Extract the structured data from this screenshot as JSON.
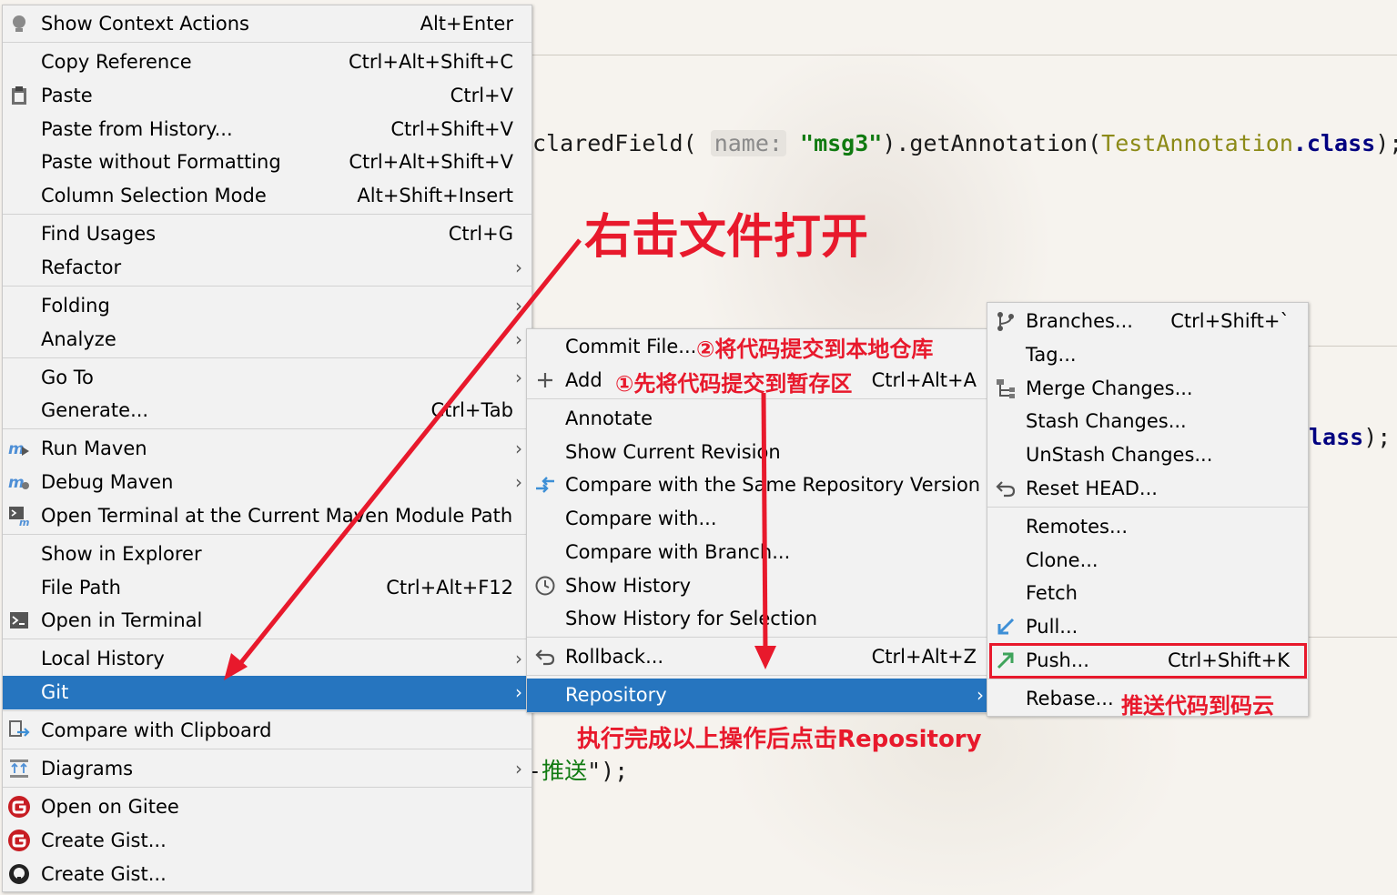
{
  "editor": {
    "line1": {
      "prefix": "claredField(",
      "hint": "name:",
      "str": "\"msg3\"",
      "mid": ").getAnnotation(",
      "cls": "TestAnnotation",
      "kw": ".class",
      "end": ");"
    },
    "line2": {
      "kw": "lass",
      "end": ");"
    },
    "line3": {
      "prefix": "-",
      "str": "推送",
      "end": "\");"
    }
  },
  "context_menu": {
    "items": [
      {
        "label": "Show Context Actions",
        "shortcut": "Alt+Enter",
        "icon": "lightbulb-icon"
      },
      {
        "label": "Copy Reference",
        "shortcut": "Ctrl+Alt+Shift+C"
      },
      {
        "label": "Paste",
        "shortcut": "Ctrl+V",
        "icon": "clipboard-icon"
      },
      {
        "label": "Paste from History...",
        "shortcut": "Ctrl+Shift+V"
      },
      {
        "label": "Paste without Formatting",
        "shortcut": "Ctrl+Alt+Shift+V"
      },
      {
        "label": "Column Selection Mode",
        "shortcut": "Alt+Shift+Insert"
      },
      {
        "label": "Find Usages",
        "shortcut": "Ctrl+G"
      },
      {
        "label": "Refactor",
        "submenu": true
      },
      {
        "label": "Folding",
        "submenu": true
      },
      {
        "label": "Analyze",
        "submenu": true
      },
      {
        "label": "Go To",
        "submenu": true
      },
      {
        "label": "Generate...",
        "shortcut": "Ctrl+Tab"
      },
      {
        "label": "Run Maven",
        "submenu": true,
        "icon": "maven-run-icon"
      },
      {
        "label": "Debug Maven",
        "submenu": true,
        "icon": "maven-debug-icon"
      },
      {
        "label": "Open Terminal at the Current Maven Module Path",
        "icon": "maven-terminal-icon"
      },
      {
        "label": "Show in Explorer"
      },
      {
        "label": "File Path",
        "shortcut": "Ctrl+Alt+F12"
      },
      {
        "label": "Open in Terminal",
        "icon": "terminal-icon"
      },
      {
        "label": "Local History",
        "submenu": true
      },
      {
        "label": "Git",
        "submenu": true,
        "selected": true
      },
      {
        "label": "Compare with Clipboard",
        "icon": "compare-icon"
      },
      {
        "label": "Diagrams",
        "submenu": true,
        "icon": "diagram-icon"
      },
      {
        "label": "Open on Gitee",
        "icon": "gitee-icon"
      },
      {
        "label": "Create Gist...",
        "icon": "gitee-icon"
      },
      {
        "label": "Create Gist...",
        "icon": "github-icon"
      }
    ]
  },
  "git_menu": {
    "items": [
      {
        "label": "Commit File..."
      },
      {
        "label": "Add",
        "shortcut": "Ctrl+Alt+A",
        "icon": "plus-icon"
      },
      {
        "label": "Annotate"
      },
      {
        "label": "Show Current Revision"
      },
      {
        "label": "Compare with the Same Repository Version",
        "icon": "compare-icon"
      },
      {
        "label": "Compare with..."
      },
      {
        "label": "Compare with Branch..."
      },
      {
        "label": "Show History",
        "icon": "clock-icon"
      },
      {
        "label": "Show History for Selection"
      },
      {
        "label": "Rollback...",
        "shortcut": "Ctrl+Alt+Z",
        "icon": "rollback-icon"
      },
      {
        "label": "Repository",
        "submenu": true,
        "selected": true
      }
    ]
  },
  "repository_menu": {
    "items": [
      {
        "label": "Branches...",
        "shortcut": "Ctrl+Shift+`",
        "icon": "branch-icon"
      },
      {
        "label": "Tag..."
      },
      {
        "label": "Merge Changes...",
        "icon": "merge-icon"
      },
      {
        "label": "Stash Changes..."
      },
      {
        "label": "UnStash Changes..."
      },
      {
        "label": "Reset HEAD...",
        "icon": "reset-icon"
      },
      {
        "label": "Remotes..."
      },
      {
        "label": "Clone..."
      },
      {
        "label": "Fetch"
      },
      {
        "label": "Pull...",
        "icon": "pull-icon"
      },
      {
        "label": "Push...",
        "shortcut": "Ctrl+Shift+K",
        "icon": "push-icon"
      },
      {
        "label": "Rebase..."
      }
    ]
  },
  "annotations": {
    "right_click": "右击文件打开",
    "commit": "②将代码提交到本地仓库",
    "add": "①先将代码提交到暂存区",
    "repository": "执行完成以上操作后点击Repository",
    "push": "推送代码到码云"
  },
  "colors": {
    "selection": "#2675bf",
    "annotation": "#e8192c",
    "menu_bg": "#f2f2f2"
  }
}
